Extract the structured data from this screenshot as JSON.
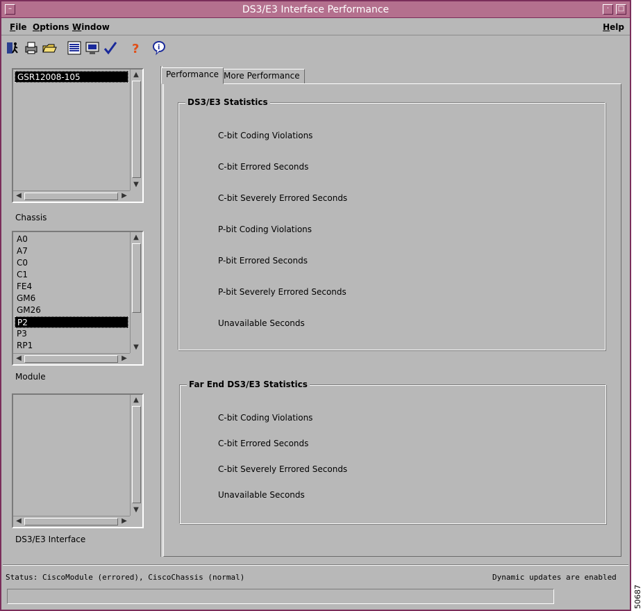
{
  "window": {
    "title": "DS3/E3 Interface Performance"
  },
  "menubar": {
    "file": {
      "key": "F",
      "rest": "ile"
    },
    "options": {
      "key": "O",
      "rest": "ptions"
    },
    "window": {
      "key": "W",
      "rest": "indow"
    },
    "help": {
      "key": "H",
      "rest": "elp"
    }
  },
  "toolbar": [
    {
      "icon": "exit-icon"
    },
    {
      "icon": "print-icon"
    },
    {
      "icon": "open-folder-icon"
    },
    {
      "icon": "list-icon"
    },
    {
      "icon": "display-icon"
    },
    {
      "icon": "checkmark-icon"
    },
    {
      "icon": "help-question-icon"
    },
    {
      "icon": "info-icon"
    }
  ],
  "chassis": {
    "label": "Chassis",
    "items": [
      "GSR12008-105"
    ],
    "selected": 0
  },
  "module": {
    "label": "Module",
    "items": [
      "A0",
      "A7",
      "C0",
      "C1",
      "FE4",
      "GM6",
      "GM26",
      "P2",
      "P3",
      "RP1"
    ],
    "selected": 7
  },
  "interface": {
    "label": "DS3/E3 Interface",
    "items": []
  },
  "tabs": [
    {
      "label": "Performance",
      "active": true
    },
    {
      "label": "More Performance",
      "active": false
    }
  ],
  "ds3_stats": {
    "title": "DS3/E3 Statistics",
    "rows": [
      "C-bit Coding Violations",
      "C-bit Errored Seconds",
      "C-bit Severely Errored Seconds",
      "P-bit Coding Violations",
      "P-bit Errored Seconds",
      "P-bit Severely Errored Seconds",
      "Unavailable Seconds"
    ]
  },
  "far_end_stats": {
    "title": "Far End DS3/E3 Statistics",
    "rows": [
      "C-bit Coding Violations",
      "C-bit Errored Seconds",
      "C-bit Severely Errored Seconds",
      "Unavailable Seconds"
    ]
  },
  "status": {
    "left": "Status: CiscoModule (errored), CiscoChassis (normal)",
    "right": "Dynamic updates are enabled"
  },
  "figure_number": "50687"
}
